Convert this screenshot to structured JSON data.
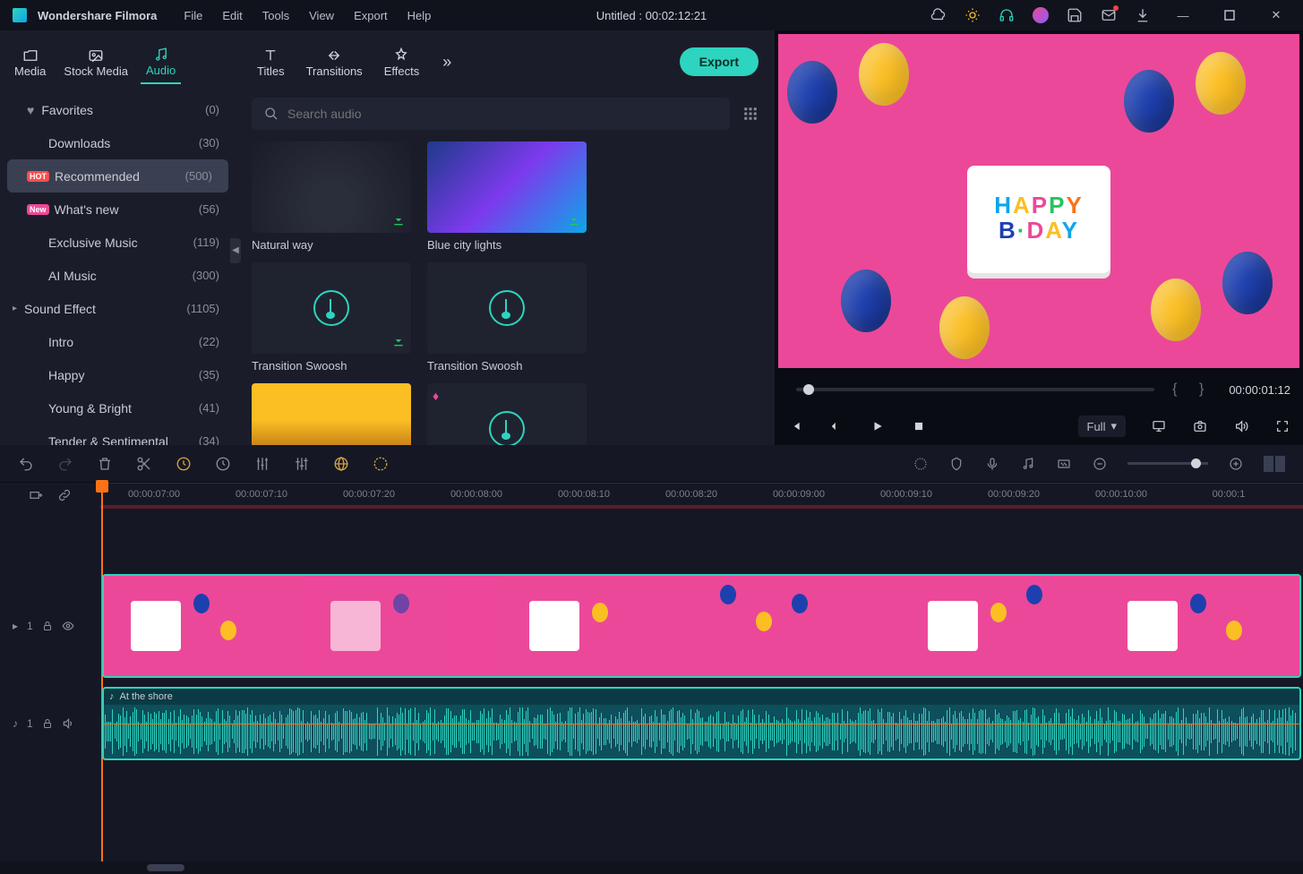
{
  "app": {
    "title": "Wondershare Filmora",
    "project": "Untitled : 00:02:12:21"
  },
  "menus": [
    "File",
    "Edit",
    "Tools",
    "View",
    "Export",
    "Help"
  ],
  "topTabs": [
    {
      "label": "Media"
    },
    {
      "label": "Stock Media"
    },
    {
      "label": "Audio",
      "active": true
    },
    {
      "label": "Titles"
    },
    {
      "label": "Transitions"
    },
    {
      "label": "Effects"
    }
  ],
  "tabsOverflow": [
    {
      "label": "Media"
    },
    {
      "label": "Stock Media"
    },
    {
      "label": "Audio",
      "active": true
    },
    {
      "label": "Titles"
    },
    {
      "label": "Transitions"
    },
    {
      "label": "Effects"
    }
  ],
  "export": {
    "label": "Export"
  },
  "search": {
    "placeholder": "Search audio"
  },
  "sidebar": {
    "items": [
      {
        "label": "Favorites",
        "count": "(0)",
        "heart": true
      },
      {
        "label": "Downloads",
        "count": "(30)",
        "indent": true
      },
      {
        "label": "Recommended",
        "count": "(500)",
        "hot": true,
        "selected": true
      },
      {
        "label": "What's new",
        "count": "(56)",
        "new": true
      },
      {
        "label": "Exclusive Music",
        "count": "(119)",
        "indent": true
      },
      {
        "label": "AI Music",
        "count": "(300)",
        "indent": true
      },
      {
        "label": "Sound Effect",
        "count": "(1105)",
        "expand": true
      },
      {
        "label": "Intro",
        "count": "(22)",
        "indent": true
      },
      {
        "label": "Happy",
        "count": "(35)",
        "indent": true
      },
      {
        "label": "Young & Bright",
        "count": "(41)",
        "indent": true
      },
      {
        "label": "Tender & Sentimental",
        "count": "(34)",
        "indent": true
      }
    ]
  },
  "tiles": [
    {
      "label": "Natural way",
      "kind": "record",
      "download": true
    },
    {
      "label": "Blue city lights",
      "kind": "city",
      "download": true
    },
    {
      "label": "Transition Swoosh",
      "kind": "audio",
      "download": true
    },
    {
      "label": "Transition Swoosh",
      "kind": "audio"
    },
    {
      "label": "",
      "kind": "beach"
    },
    {
      "label": "",
      "kind": "audio",
      "diamond": true
    }
  ],
  "preview": {
    "timecode": "00:00:01:12",
    "quality": "Full"
  },
  "timeline": {
    "ruler": [
      "00:00:07:00",
      "00:00:07:10",
      "00:00:07:20",
      "00:00:08:00",
      "00:00:08:10",
      "00:00:08:20",
      "00:00:09:00",
      "00:00:09:10",
      "00:00:09:20",
      "00:00:10:00",
      "00:00:1"
    ],
    "videoTrack": {
      "label": "1"
    },
    "audioTrack": {
      "label": "1",
      "clipName": "At the shore"
    }
  }
}
